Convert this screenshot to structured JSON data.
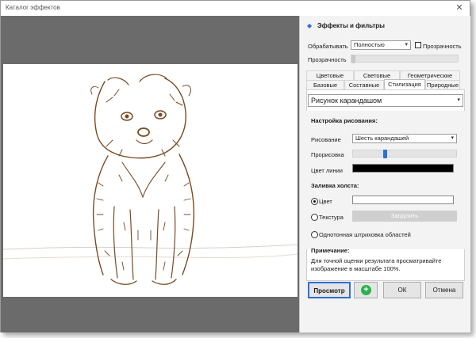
{
  "window": {
    "title": "Каталог эффектов",
    "close_glyph": "✕"
  },
  "panel": {
    "header_title": "Эффекты и фильтры",
    "header_icon": "diamond-icon",
    "process_label": "Обрабатывать",
    "process_value": "Полностью",
    "transparency_checkbox_label": "Прозрачность",
    "transparency_label": "Прозрачность",
    "tabs_row1": [
      "Цветовые",
      "Световые",
      "Геометрические"
    ],
    "tabs_row2": [
      "Базовые",
      "Составные",
      "Стилизация",
      "Природные"
    ],
    "active_tab": "Стилизация",
    "effect_value": "Рисунок карандашом",
    "settings_heading": "Настройка рисования:",
    "drawing_label": "Рисование",
    "drawing_value": "Шесть карандашей",
    "drawing_strength_label": "Прорисовка",
    "drawing_strength_level": 0.3,
    "line_color_label": "Цвет линии",
    "line_color_value": "#000000",
    "canvas_fill_heading": "Заливка холста:",
    "fill_color_label": "Цвет",
    "fill_texture_label": "Текстура",
    "texture_button_label": "Загрузить",
    "fill_hatching_label": "Однотонная штриховка областей",
    "note_heading": "Примечание:",
    "note_text": "Для точной оценки результата просматривайте изображение в масштабе 100%.",
    "preview_button": "Просмотр",
    "add_button_glyph": "+",
    "ok_button": "ОК",
    "cancel_button": "Отмена"
  },
  "colors": {
    "accent": "#2e6fd6",
    "add_button_green": "#2bb24c",
    "sketch_brown": "#7a4a22"
  }
}
